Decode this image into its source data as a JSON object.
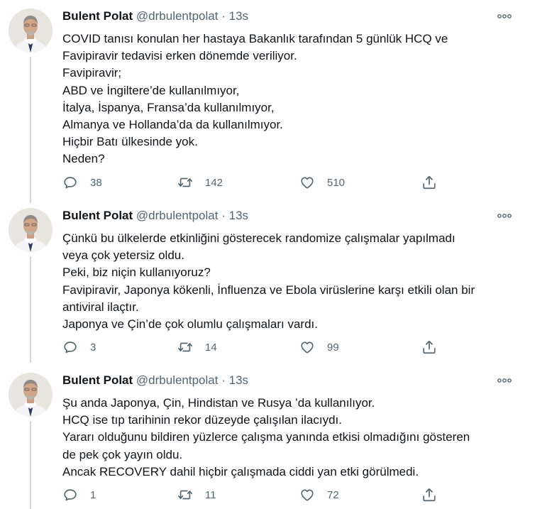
{
  "tweets": [
    {
      "author": "Bulent Polat",
      "handle": "@drbulentpolat",
      "separator": "·",
      "time": "13s",
      "lines": [
        "COVID tanısı konulan her hastaya Bakanlık tarafından 5 günlük HCQ ve",
        "Favipiravir tedavisi erken dönemde veriliyor.",
        "Favipiravir;",
        "ABD ve İngiltere’de kullanılmıyor,",
        "İtalya, İspanya, Fransa’da kullanılmıyor,",
        "Almanya ve Hollanda’da da kullanılmıyor.",
        "Hiçbir Batı ülkesinde yok.",
        "Neden?"
      ],
      "replies": "38",
      "retweets": "142",
      "likes": "510"
    },
    {
      "author": "Bulent Polat",
      "handle": "@drbulentpolat",
      "separator": "·",
      "time": "13s",
      "lines": [
        "Çünkü bu ülkelerde etkinliğini gösterecek randomize çalışmalar yapılmadı",
        "veya çok yetersiz oldu.",
        "Peki, biz niçin kullanıyoruz?",
        "Favipiravir, Japonya kökenli, İnfluenza ve Ebola virüslerine karşı etkili olan bir",
        "antiviral ilaçtır.",
        "Japonya ve Çin’de çok olumlu çalışmaları vardı."
      ],
      "replies": "3",
      "retweets": "14",
      "likes": "99"
    },
    {
      "author": "Bulent Polat",
      "handle": "@drbulentpolat",
      "separator": "·",
      "time": "13s",
      "lines": [
        "Şu anda Japonya, Çin, Hindistan ve Rusya ’da kullanılıyor.",
        "HCQ ise tıp tarihinin rekor düzeyde çalışılan ilacıydı.",
        "Yararı olduğunu bildiren yüzlerce çalışma yanında etkisi olmadığını gösteren",
        "de pek çok yayın oldu.",
        "Ancak RECOVERY dahil hiçbir çalışmada ciddi yan etki görülmedi."
      ],
      "replies": "1",
      "retweets": "11",
      "likes": "72"
    }
  ],
  "icons": {
    "more": "more-horizontal-icon",
    "reply": "reply-icon",
    "retweet": "retweet-icon",
    "like": "heart-icon",
    "share": "share-icon"
  },
  "colors": {
    "text": "#0f1419",
    "secondary": "#536471",
    "thread_line": "#cfd9de"
  }
}
